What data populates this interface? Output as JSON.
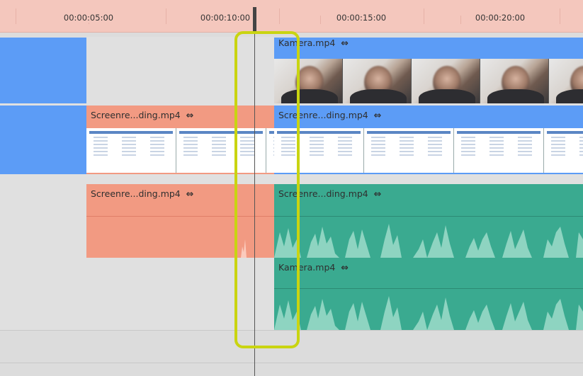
{
  "ruler": {
    "timecodes": [
      "00:00:05:00",
      "00:00:10:00",
      "00:00:15:00",
      "00:00:20:00"
    ]
  },
  "tracks": {
    "video_top": {
      "label": "Kamera.mp4",
      "link_icon": "link-icon"
    },
    "video_screen_left": {
      "label": "Screenre...ding.mp4",
      "link_icon": "link-icon"
    },
    "video_screen_right": {
      "label": "Screenre...ding.mp4",
      "link_icon": "link-icon"
    },
    "audio_screen_left": {
      "label": "Screenre...ding.mp4",
      "link_icon": "link-icon"
    },
    "audio_screen_right": {
      "label": "Screenre...ding.mp4",
      "link_icon": "link-icon"
    },
    "audio_camera": {
      "label": "Kamera.mp4",
      "link_icon": "link-icon"
    }
  },
  "colors": {
    "ruler": "#f4c7bd",
    "video_clip": "#5c9cf6",
    "unlinked_clip": "#f29a82",
    "audio_clip": "#3aaa90",
    "highlight": "#c9d411"
  },
  "link_glyph": "⇔"
}
